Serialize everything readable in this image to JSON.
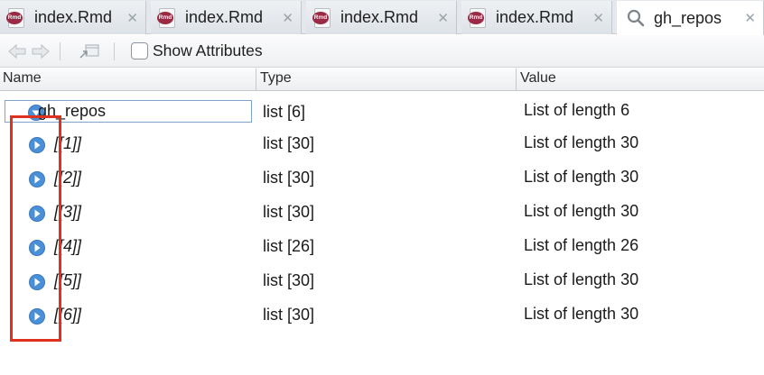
{
  "tabs": [
    {
      "label": "index.Rmd",
      "icon": "rmd-file-icon",
      "active": false
    },
    {
      "label": "index.Rmd",
      "icon": "rmd-file-icon",
      "active": false
    },
    {
      "label": "index.Rmd",
      "icon": "rmd-file-icon",
      "active": false
    },
    {
      "label": "index.Rmd",
      "icon": "rmd-file-icon",
      "active": false
    },
    {
      "label": "gh_repos",
      "icon": "search-icon",
      "active": true
    }
  ],
  "tab_close_glyph": "✕",
  "rmd_badge_text": "Rmd",
  "toolbar": {
    "show_attributes_label": "Show Attributes",
    "show_attributes_checked": false
  },
  "columns": {
    "name": "Name",
    "type": "Type",
    "value": "Value"
  },
  "root": {
    "name": "gh_repos",
    "type": "list [6]",
    "value": "List of length 6",
    "expanded": true
  },
  "rows": [
    {
      "name": "[[1]]",
      "type": "list [30]",
      "value": "List of length 30"
    },
    {
      "name": "[[2]]",
      "type": "list [30]",
      "value": "List of length 30"
    },
    {
      "name": "[[3]]",
      "type": "list [30]",
      "value": "List of length 30"
    },
    {
      "name": "[[4]]",
      "type": "list [26]",
      "value": "List of length 26"
    },
    {
      "name": "[[5]]",
      "type": "list [30]",
      "value": "List of length 30"
    },
    {
      "name": "[[6]]",
      "type": "list [30]",
      "value": "List of length 30"
    }
  ],
  "colors": {
    "rmd_badge": "#9b2b45",
    "expand_icon": "#4a90d9",
    "highlight": "#e0301e",
    "selection_border": "#7fa3cf"
  }
}
